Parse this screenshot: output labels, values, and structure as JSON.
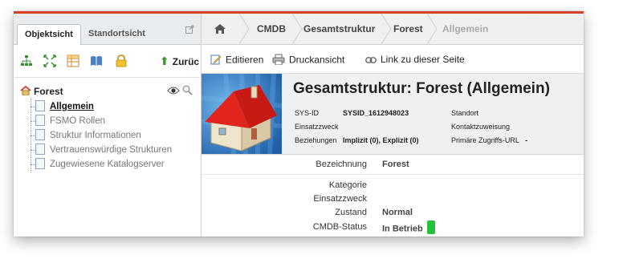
{
  "left_panel": {
    "tabs": [
      {
        "label": "Objektsicht",
        "active": true
      },
      {
        "label": "Standortsicht",
        "active": false
      }
    ],
    "toolbar": {
      "icons": [
        "tree-structure-icon",
        "expand-arrows-icon",
        "table-grid-icon",
        "book-icon",
        "lock-icon"
      ],
      "back_label": "Zurüc"
    },
    "tree": {
      "root": "Forest",
      "items": [
        {
          "label": "Allgemein",
          "selected": true
        },
        {
          "label": "FSMO Rollen",
          "selected": false
        },
        {
          "label": "Struktur Informationen",
          "selected": false
        },
        {
          "label": "Vertrauenswürdige Strukturen",
          "selected": false
        },
        {
          "label": "Zugewiesene Katalogserver",
          "selected": false
        }
      ]
    }
  },
  "breadcrumb": {
    "items": [
      "CMDB",
      "Gesamtstruktur",
      "Forest",
      "Allgemein"
    ]
  },
  "toolbar": {
    "edit": "Editieren",
    "print": "Druckansicht",
    "link": "Link zu dieser Seite"
  },
  "header": {
    "title": "Gesamtstruktur: Forest (Allgemein)",
    "sysid_label": "SYS-ID",
    "sysid_value": "SYSID_1612948023",
    "purpose_label": "Einsatzzweck",
    "relations_label": "Beziehungen",
    "relations_value": "Implizit (0), Explizit (0)",
    "location_label": "Standort",
    "contact_label": "Kontaktzuweisung",
    "url_label": "Primäre Zugriffs-URL",
    "url_value": "-"
  },
  "details": {
    "bezeichnung_label": "Bezeichnung",
    "bezeichnung_value": "Forest",
    "kategorie_label": "Kategorie",
    "einsatzzweck_label": "Einsatzzweck",
    "zustand_label": "Zustand",
    "zustand_value": "Normal",
    "status_label": "CMDB-Status",
    "status_value": "In Betrieb",
    "status_color": "#24c23a"
  },
  "colors": {
    "accent_red": "#d9412f",
    "house_roof": "#e0251c",
    "header_bg": "#eef0f2"
  }
}
